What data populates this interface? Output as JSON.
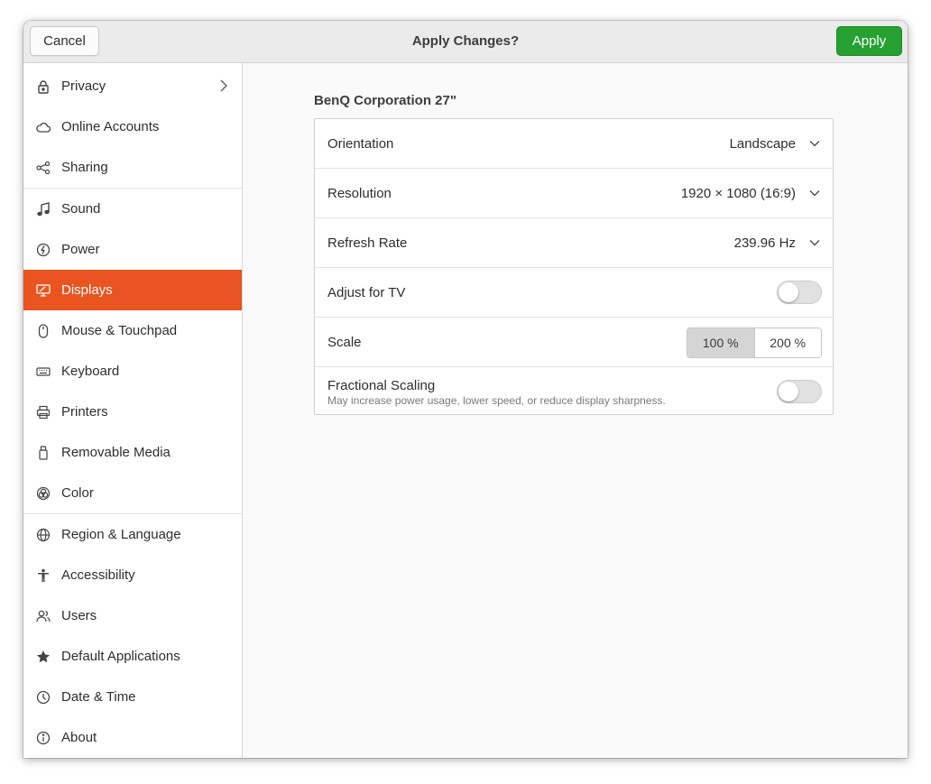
{
  "header": {
    "title": "Apply Changes?",
    "cancel_label": "Cancel",
    "apply_label": "Apply",
    "apply_color": "#26a131"
  },
  "sidebar": {
    "accent_color": "#e95420",
    "items": [
      {
        "label": "Privacy",
        "icon": "lock-icon",
        "has_chevron": true
      },
      {
        "label": "Online Accounts",
        "icon": "cloud-icon"
      },
      {
        "label": "Sharing",
        "icon": "share-icon"
      },
      {
        "label": "Sound",
        "icon": "music-note-icon"
      },
      {
        "label": "Power",
        "icon": "power-icon"
      },
      {
        "label": "Displays",
        "icon": "display-icon",
        "selected": true
      },
      {
        "label": "Mouse & Touchpad",
        "icon": "mouse-icon"
      },
      {
        "label": "Keyboard",
        "icon": "keyboard-icon"
      },
      {
        "label": "Printers",
        "icon": "printer-icon"
      },
      {
        "label": "Removable Media",
        "icon": "removable-media-icon"
      },
      {
        "label": "Color",
        "icon": "color-icon"
      },
      {
        "label": "Region & Language",
        "icon": "globe-icon"
      },
      {
        "label": "Accessibility",
        "icon": "accessibility-icon"
      },
      {
        "label": "Users",
        "icon": "users-icon"
      },
      {
        "label": "Default Applications",
        "icon": "star-icon"
      },
      {
        "label": "Date & Time",
        "icon": "clock-icon"
      },
      {
        "label": "About",
        "icon": "info-icon"
      }
    ]
  },
  "display": {
    "monitor_name": "BenQ Corporation 27\"",
    "orientation": {
      "label": "Orientation",
      "value": "Landscape"
    },
    "resolution": {
      "label": "Resolution",
      "value": "1920 × 1080 (16:9)"
    },
    "refresh_rate": {
      "label": "Refresh Rate",
      "value": "239.96 Hz"
    },
    "adjust_tv": {
      "label": "Adjust for TV",
      "enabled": false
    },
    "scale": {
      "label": "Scale",
      "options": [
        "100 %",
        "200 %"
      ],
      "selected": "100 %"
    },
    "fractional_scaling": {
      "label": "Fractional Scaling",
      "description": "May increase power usage, lower speed, or reduce display sharpness.",
      "enabled": false
    }
  }
}
